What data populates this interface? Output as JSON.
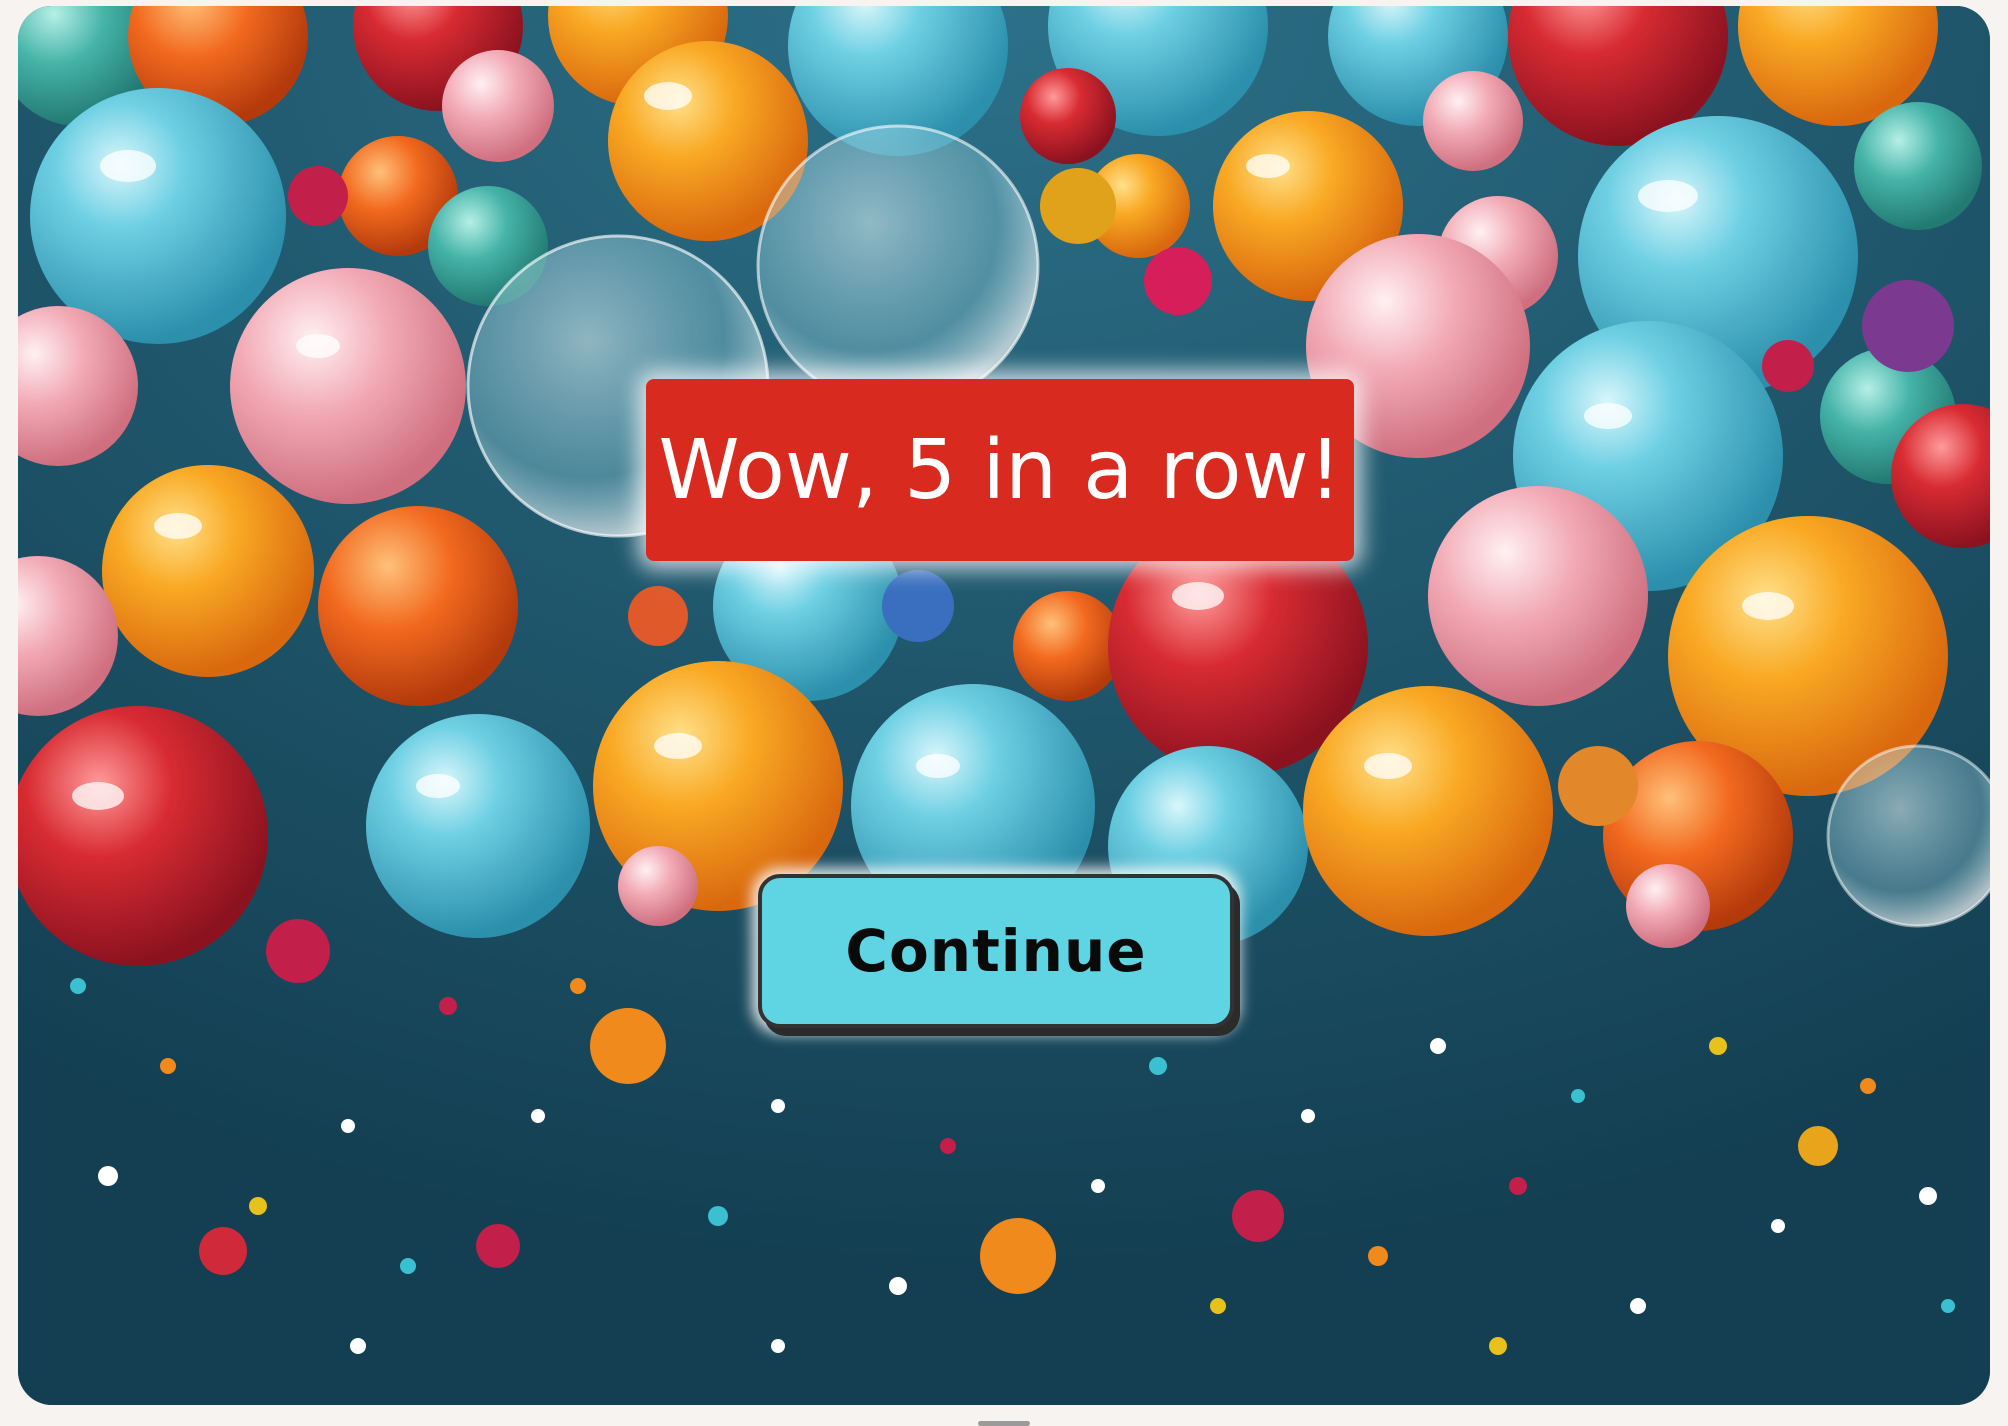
{
  "game": {
    "message": "Wow, 5 in a row!",
    "continue_label": "Continue"
  },
  "background": {
    "icon": "balloons-and-confetti-image",
    "colors": {
      "backdrop": "#1e5a71",
      "cyan": "#5cc3dc",
      "orange": "#f7a21b",
      "red": "#c8232c",
      "pink": "#f3a9b4",
      "teal": "#3aa59c"
    }
  },
  "colors": {
    "banner": "#d92a1f",
    "button": "#5fd4e2",
    "button_border": "#333333"
  }
}
